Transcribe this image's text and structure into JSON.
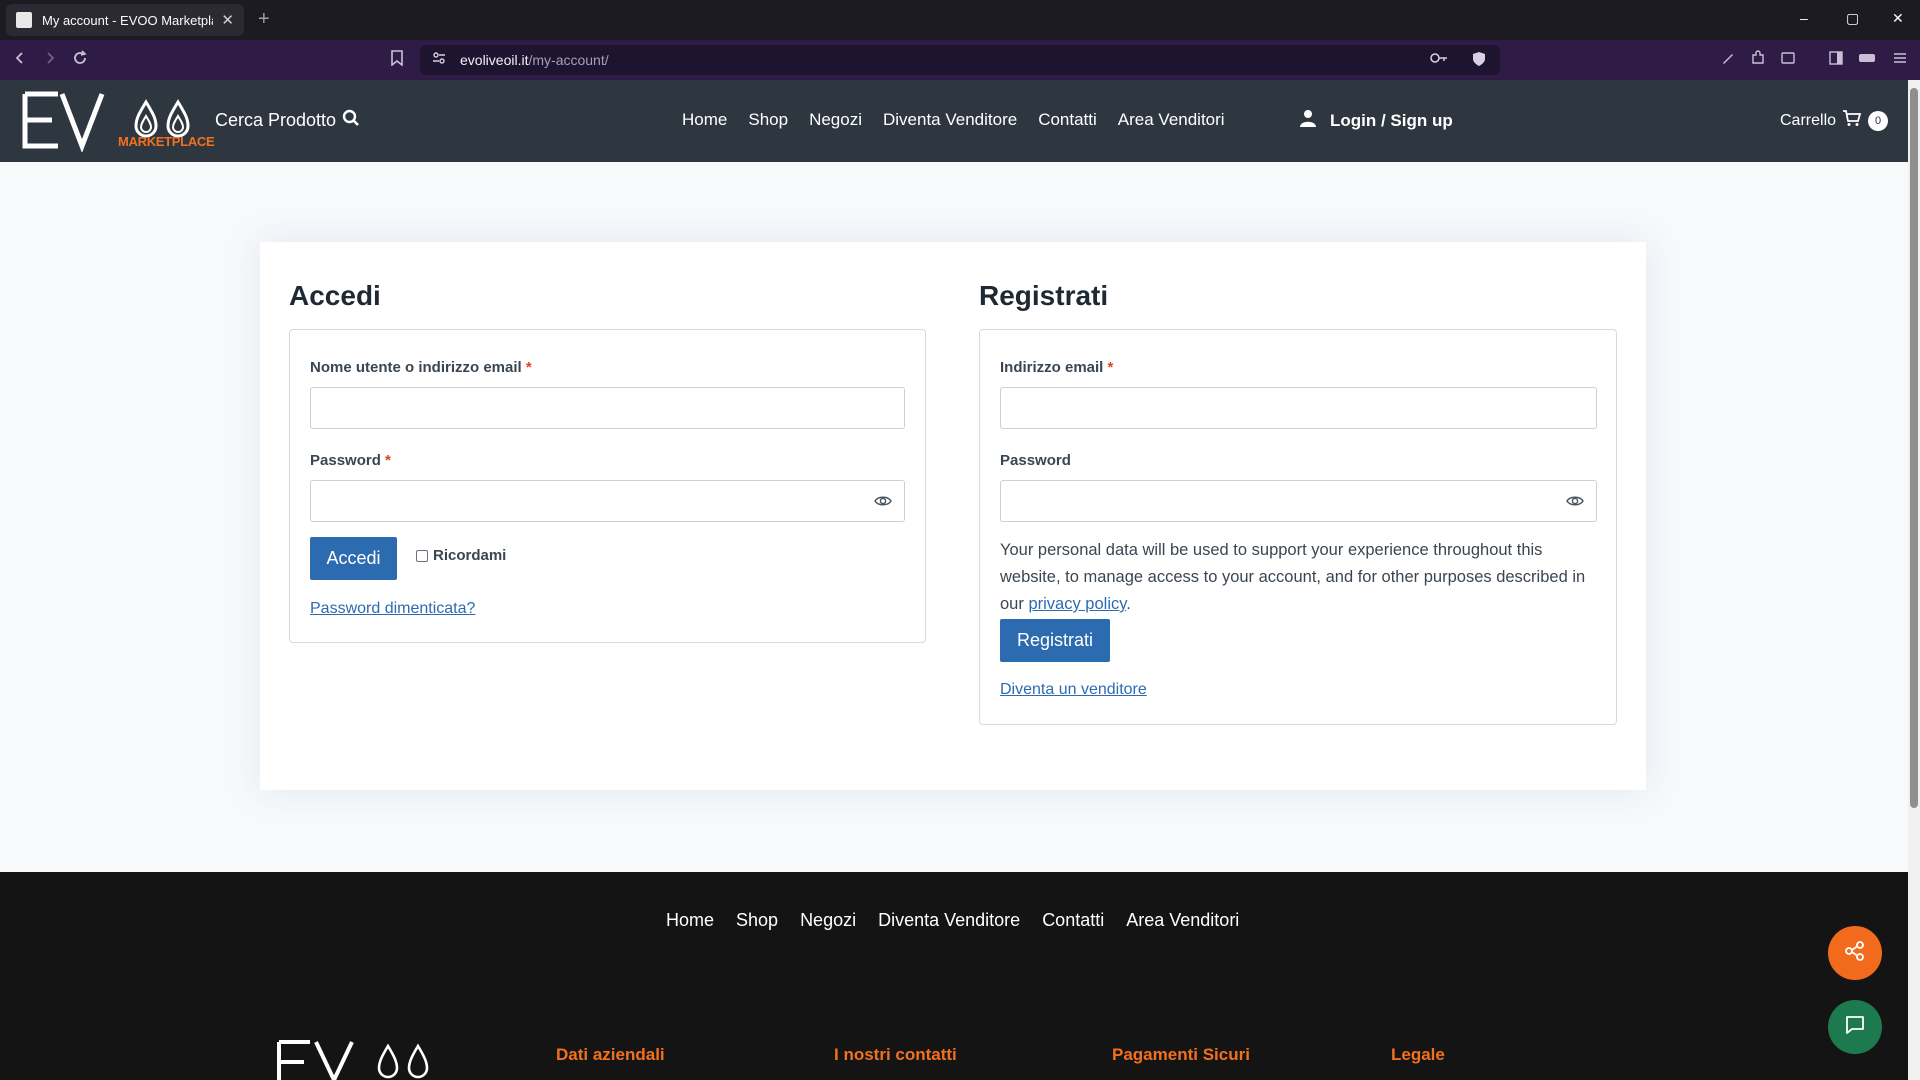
{
  "browser": {
    "tab_title": "My account - EVOO Marketplace",
    "tab_close": "✕",
    "new_tab": "+",
    "url_host": "evoliveoil.it",
    "url_path": "/my-account/",
    "window_controls": [
      "–",
      "▢",
      "✕"
    ]
  },
  "header": {
    "logo_text": "EV",
    "logo_sub": "MARKETPLACE",
    "search_label": "Cerca Prodotto",
    "nav": [
      "Home",
      "Shop",
      "Negozi",
      "Diventa Venditore",
      "Contatti",
      "Area Venditori"
    ],
    "login_label": "Login / Sign up",
    "cart_label": "Carrello",
    "cart_count": "0"
  },
  "login": {
    "title": "Accedi",
    "username_label": "Nome utente o indirizzo email",
    "password_label": "Password",
    "required_mark": "*",
    "submit_label": "Accedi",
    "remember_label": "Ricordami",
    "forgot_link": "Password dimenticata?"
  },
  "register": {
    "title": "Registrati",
    "email_label": "Indirizzo email",
    "password_label": "Password",
    "required_mark": "*",
    "privacy_text_before": "Your personal data will be used to support your experience throughout this website, to manage access to your account, and for other purposes described in our",
    "privacy_link": "privacy policy",
    "privacy_text_after": ".",
    "submit_label": "Registrati",
    "vendor_link": "Diventa un venditore"
  },
  "footer": {
    "nav": [
      "Home",
      "Shop",
      "Negozi",
      "Diventa Venditore",
      "Contatti",
      "Area Venditori"
    ],
    "headings": [
      "Dati aziendali",
      "I nostri contatti",
      "Pagamenti Sicuri",
      "Legale"
    ],
    "logo_text": "EV"
  },
  "colors": {
    "header_bg": "#2e3640",
    "button_blue": "#2d6bb1",
    "accent_orange": "#f2701e",
    "share_fab": "#f26b1d",
    "chat_fab": "#1d7a4f",
    "required_red": "#e2401c"
  },
  "icons": [
    "search-icon",
    "user-icon",
    "cart-icon",
    "eye-icon",
    "share-icon",
    "chat-icon",
    "bookmark-icon",
    "reload-icon",
    "back-icon",
    "forward-icon",
    "key-icon",
    "shield-icon",
    "extensions-icon",
    "sidebar-icon",
    "menu-icon"
  ]
}
